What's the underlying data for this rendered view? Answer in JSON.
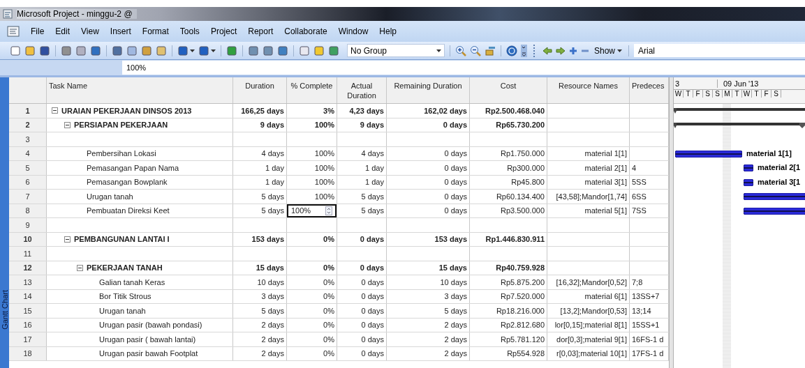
{
  "window": {
    "title": "Microsoft Project - minggu-2 @"
  },
  "menu": [
    {
      "label": "File"
    },
    {
      "label": "Edit"
    },
    {
      "label": "View"
    },
    {
      "label": "Insert"
    },
    {
      "label": "Format"
    },
    {
      "label": "Tools"
    },
    {
      "label": "Project"
    },
    {
      "label": "Report"
    },
    {
      "label": "Collaborate"
    },
    {
      "label": "Window"
    },
    {
      "label": "Help"
    }
  ],
  "toolbar": {
    "group": "No Group",
    "show": "Show",
    "font": "Arial"
  },
  "entry_bar": {
    "value": "100%"
  },
  "view_bar": {
    "label": "Gantt Chart"
  },
  "table": {
    "columns": [
      "Task Name",
      "Duration",
      "% Complete",
      "Actual Duration",
      "Remaining Duration",
      "Cost",
      "Resource Names",
      "Predeces"
    ],
    "tasks": [
      {
        "id": "1",
        "name": "URAIAN PEKERJAAN DINSOS 2013",
        "duration": "166,25 days",
        "complete": "3%",
        "actual": "4,23 days",
        "remaining": "162,02 days",
        "cost": "Rp2.500.468.040",
        "expanded": true,
        "editing": false,
        "children": [
          {
            "id": "2",
            "name": "PERSIAPAN PEKERJAAN",
            "duration": "9 days",
            "complete": "100%",
            "actual": "9 days",
            "remaining": "0 days",
            "cost": "Rp65.730.200",
            "expanded": true,
            "editing": false,
            "children": [
              {
                "id": "3"
              },
              {
                "id": "4",
                "name": "Pembersihan Lokasi",
                "duration": "4 days",
                "complete": "100%",
                "actual": "4 days",
                "remaining": "0 days",
                "cost": "Rp1.750.000",
                "resources": "material 1[1]",
                "editing": false
              },
              {
                "id": "5",
                "name": "Pemasangan Papan Nama",
                "duration": "1 day",
                "complete": "100%",
                "actual": "1 day",
                "remaining": "0 days",
                "cost": "Rp300.000",
                "resources": "material 2[1]",
                "predecessors": "4",
                "editing": false
              },
              {
                "id": "6",
                "name": "Pemasangan Bowplank",
                "duration": "1 day",
                "complete": "100%",
                "actual": "1 day",
                "remaining": "0 days",
                "cost": "Rp45.800",
                "resources": "material 3[1]",
                "predecessors": "5SS",
                "editing": false
              },
              {
                "id": "7",
                "name": "Urugan tanah",
                "duration": "5 days",
                "complete": "100%",
                "actual": "5 days",
                "remaining": "0 days",
                "cost": "Rp60.134.400",
                "resources": "[43,58];Mandor[1,74]",
                "predecessors": "6SS",
                "editing": false
              },
              {
                "id": "8",
                "name": "Pembuatan Direksi Keet",
                "duration": "5 days",
                "complete": "100%",
                "actual": "5 days",
                "remaining": "0 days",
                "cost": "Rp3.500.000",
                "resources": "material 5[1]",
                "predecessors": "7SS",
                "editing": true
              }
            ]
          },
          {
            "id": "9"
          },
          {
            "id": "10",
            "name": "PEMBANGUNAN LANTAI I",
            "duration": "153 days",
            "complete": "0%",
            "actual": "0 days",
            "remaining": "153 days",
            "cost": "Rp1.446.830.911",
            "expanded": true,
            "editing": false,
            "children": [
              {
                "id": "11"
              },
              {
                "id": "12",
                "name": "PEKERJAAN TANAH",
                "duration": "15 days",
                "complete": "0%",
                "actual": "0 days",
                "remaining": "15 days",
                "cost": "Rp40.759.928",
                "expanded": true,
                "editing": false,
                "children": [
                  {
                    "id": "13",
                    "name": "Galian tanah Keras",
                    "duration": "10 days",
                    "complete": "0%",
                    "actual": "0 days",
                    "remaining": "10 days",
                    "cost": "Rp5.875.200",
                    "resources": "[16,32];Mandor[0,52]",
                    "predecessors": "7;8",
                    "editing": false
                  },
                  {
                    "id": "14",
                    "name": "Bor Titik Strous",
                    "duration": "3 days",
                    "complete": "0%",
                    "actual": "0 days",
                    "remaining": "3 days",
                    "cost": "Rp7.520.000",
                    "resources": "material 6[1]",
                    "predecessors": "13SS+7",
                    "editing": false
                  },
                  {
                    "id": "15",
                    "name": "Urugan tanah",
                    "duration": "5 days",
                    "complete": "0%",
                    "actual": "0 days",
                    "remaining": "5 days",
                    "cost": "Rp18.216.000",
                    "resources": "[13,2];Mandor[0,53]",
                    "predecessors": "13;14",
                    "editing": false
                  },
                  {
                    "id": "16",
                    "name": "Urugan pasir (bawah pondasi)",
                    "duration": "2 days",
                    "complete": "0%",
                    "actual": "0 days",
                    "remaining": "2 days",
                    "cost": "Rp2.812.680",
                    "resources": "lor[0,15];material 8[1]",
                    "predecessors": "15SS+1",
                    "editing": false
                  },
                  {
                    "id": "17",
                    "name": "Urugan pasir ( bawah lantai)",
                    "duration": "2 days",
                    "complete": "0%",
                    "actual": "0 days",
                    "remaining": "2 days",
                    "cost": "Rp5.781.120",
                    "resources": "dor[0,3];material 9[1]",
                    "predecessors": "16FS-1 d",
                    "editing": false
                  },
                  {
                    "id": "18",
                    "name": "Urugan pasir bawah Footplat",
                    "duration": "2 days",
                    "complete": "0%",
                    "actual": "0 days",
                    "remaining": "2 days",
                    "cost": "Rp554.928",
                    "resources": "r[0,03];material 10[1]",
                    "predecessors": "17FS-1 d",
                    "editing": false
                  }
                ]
              }
            ]
          }
        ]
      }
    ]
  },
  "gantt": {
    "week_prev": "3",
    "week": "09 Jun '13",
    "days": [
      "W",
      "T",
      "F",
      "S",
      "S",
      "M",
      "T",
      "W",
      "T",
      "F",
      "S"
    ],
    "bar_labels": [
      "material 1[1]",
      "material 2[1",
      "material 3[1"
    ]
  }
}
